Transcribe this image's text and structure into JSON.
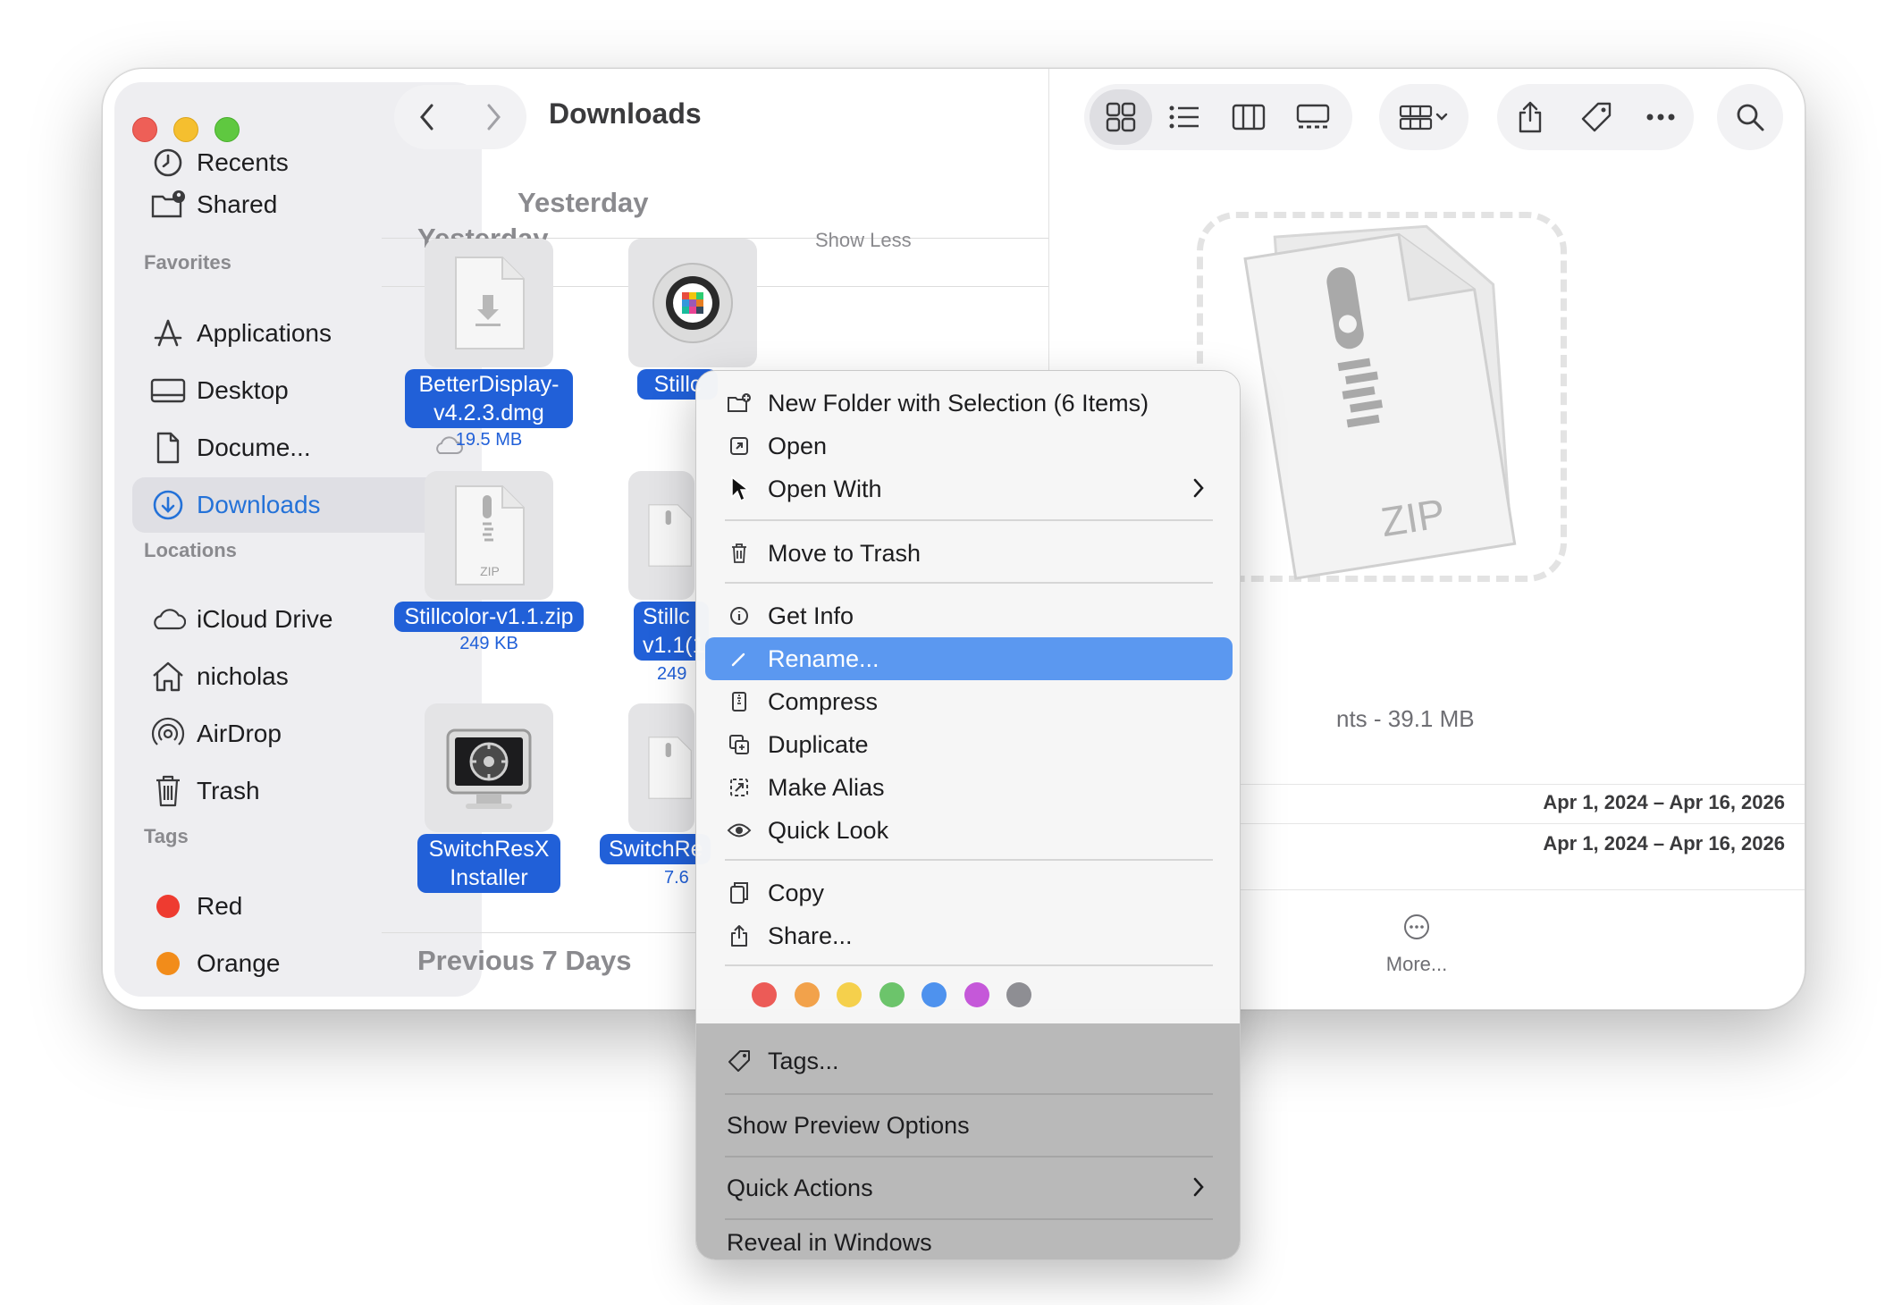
{
  "window": {
    "title": "Downloads"
  },
  "sidebar": {
    "top_items": [
      {
        "label": "Recents",
        "icon": "clock-icon"
      },
      {
        "label": "Shared",
        "icon": "shared-folder-icon"
      }
    ],
    "favorites_header": "Favorites",
    "favorites": [
      {
        "label": "Applications",
        "icon": "applications-icon"
      },
      {
        "label": "Desktop",
        "icon": "desktop-icon"
      },
      {
        "label": "Docume...",
        "icon": "document-icon"
      },
      {
        "label": "Downloads",
        "icon": "downloads-icon",
        "selected": true
      }
    ],
    "locations_header": "Locations",
    "locations": [
      {
        "label": "iCloud Drive",
        "icon": "icloud-icon"
      },
      {
        "label": "nicholas",
        "icon": "home-icon"
      },
      {
        "label": "AirDrop",
        "icon": "airdrop-icon"
      },
      {
        "label": "Trash",
        "icon": "trash-icon"
      }
    ],
    "tags_header": "Tags",
    "tags": [
      {
        "label": "Red",
        "color": "#ee3b30"
      },
      {
        "label": "Orange",
        "color": "#f28c1a"
      }
    ]
  },
  "content": {
    "section_yesterday": "Yesterday",
    "show_less": "Show Less",
    "section_previous": "Previous 7 Days",
    "files": [
      {
        "name": "BetterDisplay-v4.2.3.dmg",
        "line1": "BetterDisplay-",
        "line2": "v4.2.3.dmg",
        "size": "19.5 MB"
      },
      {
        "name": "Stillc",
        "line1": "Stillc"
      },
      {
        "name": "Stillcolor-v1.1.zip",
        "line1": "Stillcolor-v1.1.zip",
        "size": "249 KB"
      },
      {
        "name": "Stillc v1.1(1",
        "line1": "Stillc",
        "line2": "v1.1(1",
        "size": "249"
      },
      {
        "name": "SwitchResX Installer",
        "line1": "SwitchResX",
        "line2": "Installer"
      },
      {
        "name": "SwitchRe",
        "line1": "SwitchRe",
        "size": "7.6"
      }
    ]
  },
  "preview": {
    "zip_label": "ZIP",
    "meta": "nts - 39.1 MB",
    "created": "Apr 1, 2024 – Apr 16, 2026",
    "modified": "Apr 1, 2024 – Apr 16, 2026",
    "more_label": "More..."
  },
  "context_menu": {
    "items": [
      {
        "label": "New Folder with Selection (6 Items)",
        "icon": "new-folder-icon"
      },
      {
        "label": "Open",
        "icon": "open-icon"
      },
      {
        "label": "Open With",
        "icon": "none",
        "submenu": true
      },
      {
        "label": "Move to Trash",
        "icon": "trash-icon"
      },
      {
        "label": "Get Info",
        "icon": "info-icon"
      },
      {
        "label": "Rename...",
        "icon": "pencil-icon",
        "highlighted": true
      },
      {
        "label": "Compress",
        "icon": "compress-icon"
      },
      {
        "label": "Duplicate",
        "icon": "duplicate-icon"
      },
      {
        "label": "Make Alias",
        "icon": "alias-icon"
      },
      {
        "label": "Quick Look",
        "icon": "eye-icon"
      },
      {
        "label": "Copy",
        "icon": "copy-icon"
      },
      {
        "label": "Share...",
        "icon": "share-icon"
      },
      {
        "label": "Tags...",
        "icon": "tag-icon"
      },
      {
        "label": "Show Preview Options",
        "icon": "none"
      },
      {
        "label": "Quick Actions",
        "icon": "none",
        "submenu": true
      },
      {
        "label": "Reveal in Windows",
        "icon": "none"
      }
    ],
    "tag_colors": [
      "#ec5b57",
      "#f2a24b",
      "#f5d04c",
      "#6cc46b",
      "#4e92ee",
      "#c558d9",
      "#8e8e93"
    ]
  }
}
